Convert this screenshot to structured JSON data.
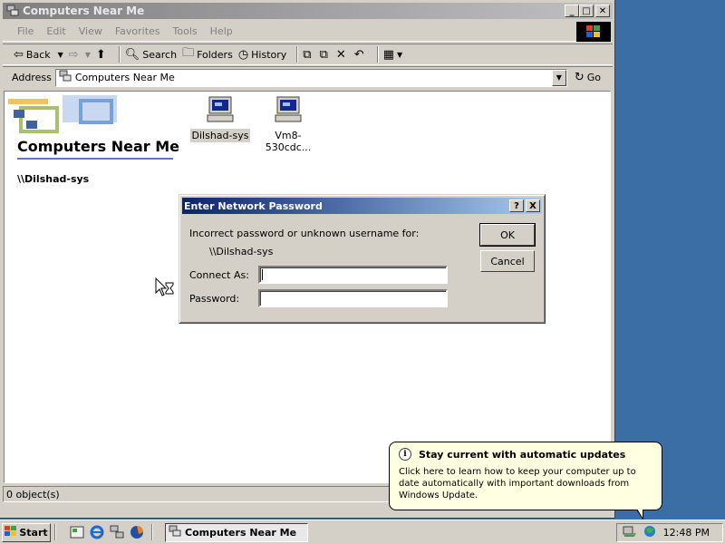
{
  "window": {
    "title": "Computers Near Me",
    "menu": [
      "File",
      "Edit",
      "View",
      "Favorites",
      "Tools",
      "Help"
    ],
    "toolbar": {
      "back": "Back",
      "search": "Search",
      "folders": "Folders",
      "history": "History"
    },
    "address": {
      "label": "Address",
      "value": "Computers Near Me",
      "go": "Go"
    },
    "webview": {
      "title": "Computers Near Me",
      "selected": "\\\\Dilshad-sys"
    },
    "files": [
      {
        "name": "Dilshad-sys",
        "icon": "computer-icon",
        "selected": true
      },
      {
        "name": "Vm8-530cdc...",
        "icon": "computer-icon",
        "selected": false
      }
    ],
    "status": "0 object(s)"
  },
  "dialog": {
    "title": "Enter Network Password",
    "message": "Incorrect password or unknown username for:",
    "resource": "\\\\Dilshad-sys",
    "connect_as_label": "Connect As:",
    "connect_as_value": "",
    "password_label": "Password:",
    "password_value": "",
    "ok": "OK",
    "cancel": "Cancel",
    "help_icon": "?",
    "close_icon": "X"
  },
  "balloon": {
    "title": "Stay current with automatic updates",
    "text": "Click here to learn how to keep your computer up to date automatically with important downloads from Windows Update."
  },
  "taskbar": {
    "start": "Start",
    "task": "Computers Near Me",
    "clock": "12:48 PM"
  },
  "colors": {
    "desktop": "#3a6ea5",
    "dialog_title": "#0a246a",
    "balloon_bg": "#ffffe1"
  }
}
